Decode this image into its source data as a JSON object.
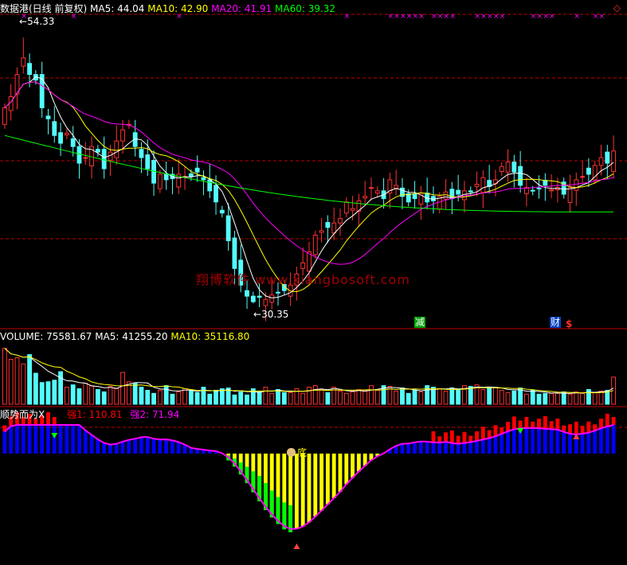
{
  "colors": {
    "up": "#ff3232",
    "down": "#54fcfc",
    "ma5": "#ffffff",
    "ma10": "#ffff00",
    "ma20": "#ff00ff",
    "ma60": "#00ff00",
    "grid": "#c00000",
    "vol_ma5": "#ffffff",
    "vol_ma10": "#ffff00",
    "ind_red": "#ff0000",
    "ind_blue": "#0000ff",
    "ind_yellow": "#ffff00",
    "ind_green": "#00ff00",
    "ind_line": "#ff00ff",
    "ind_white": "#ffffff",
    "marker_x": "#ff00ff",
    "watermark": "#a00000"
  },
  "price_panel": {
    "title": "数据港(日线 前复权)",
    "ma5_label": "MA5: 44.04",
    "ma10_label": "MA10: 42.90",
    "ma20_label": "MA20: 41.91",
    "ma60_label": "MA60: 39.32",
    "high_label": "54.33",
    "low_label": "30.35",
    "sig1": "减",
    "sig2": "财",
    "sig3": "$",
    "watermark": "翔博软件 www.xiangbosoft.com"
  },
  "volume_panel": {
    "vol_label": "VOLUME: 75581.67",
    "ma5_label": "MA5: 41255.20",
    "ma10_label": "MA10: 35116.80"
  },
  "indicator_panel": {
    "name": "顺势而为X",
    "strong1_label": "强1: 110.81",
    "strong2_label": "强2: 71.94",
    "bottom_label": "底"
  },
  "chart_data": [
    {
      "type": "candlestick",
      "title": "数据港(日线 前复权)",
      "ylim": [
        29,
        56
      ],
      "high_marker": 54.33,
      "low_marker": 30.35,
      "closes": [
        48,
        49,
        51,
        52.5,
        51,
        50.5,
        48,
        47,
        45.5,
        44.8,
        45.7,
        44.5,
        43,
        43.5,
        44.5,
        44,
        42.5,
        44,
        45,
        46,
        46.5,
        44.5,
        43.5,
        42.5,
        41.2,
        42,
        41.5,
        41.6,
        42,
        41.8,
        41.8,
        42.2,
        41.5,
        40.5,
        39.5,
        38.5,
        36,
        33.5,
        32,
        31,
        30.5,
        30.9,
        30.7,
        31.1,
        31.3,
        31.5,
        32,
        33,
        34,
        35,
        36.5,
        36.9,
        37.2,
        37.6,
        38,
        39.5,
        38.9,
        39.6,
        40,
        40.8,
        40.5,
        39.8,
        41.5,
        41,
        40,
        39.5,
        39.8,
        40.3,
        39.5,
        39.6,
        40,
        40.4,
        39.8,
        40.2,
        40.5,
        40.4,
        41.1,
        41.7,
        40.9,
        41.5,
        42.7,
        43.1,
        42.2,
        41,
        40.8,
        40.5,
        40.7,
        41,
        40.6,
        40.8,
        40.2,
        40.8,
        41.5,
        41.8,
        42,
        42.8,
        43.5,
        43,
        44.1
      ],
      "volumes": [
        72000,
        58000,
        60000,
        52000,
        64000,
        40000,
        28000,
        29000,
        31000,
        42000,
        22000,
        25000,
        20000,
        27000,
        24000,
        19000,
        16000,
        23000,
        20000,
        41000,
        29000,
        27000,
        22000,
        18000,
        14000,
        18000,
        24000,
        13000,
        16000,
        20000,
        18000,
        15000,
        22000,
        13000,
        18000,
        20000,
        21000,
        12000,
        16000,
        12000,
        20000,
        16000,
        22000,
        14000,
        19000,
        15000,
        15000,
        20000,
        14000,
        22000,
        24000,
        19000,
        15000,
        22000,
        17000,
        14000,
        16000,
        19000,
        18000,
        24000,
        19000,
        24000,
        23000,
        17000,
        21000,
        14000,
        18000,
        16000,
        24000,
        22000,
        20000,
        17000,
        21000,
        19000,
        24000,
        23000,
        25000,
        19000,
        21000,
        22000,
        18000,
        15000,
        17000,
        21000,
        13000,
        18000,
        13000,
        14000,
        14000,
        14000,
        16000,
        13000,
        16000,
        14000,
        19000,
        15000,
        17000,
        18000,
        35000
      ],
      "ma60_start": 45.5,
      "ma60_end": 38.6
    },
    {
      "type": "bar",
      "title": "顺势而为X",
      "strong1": 110.81,
      "strong2": 71.94
    }
  ]
}
